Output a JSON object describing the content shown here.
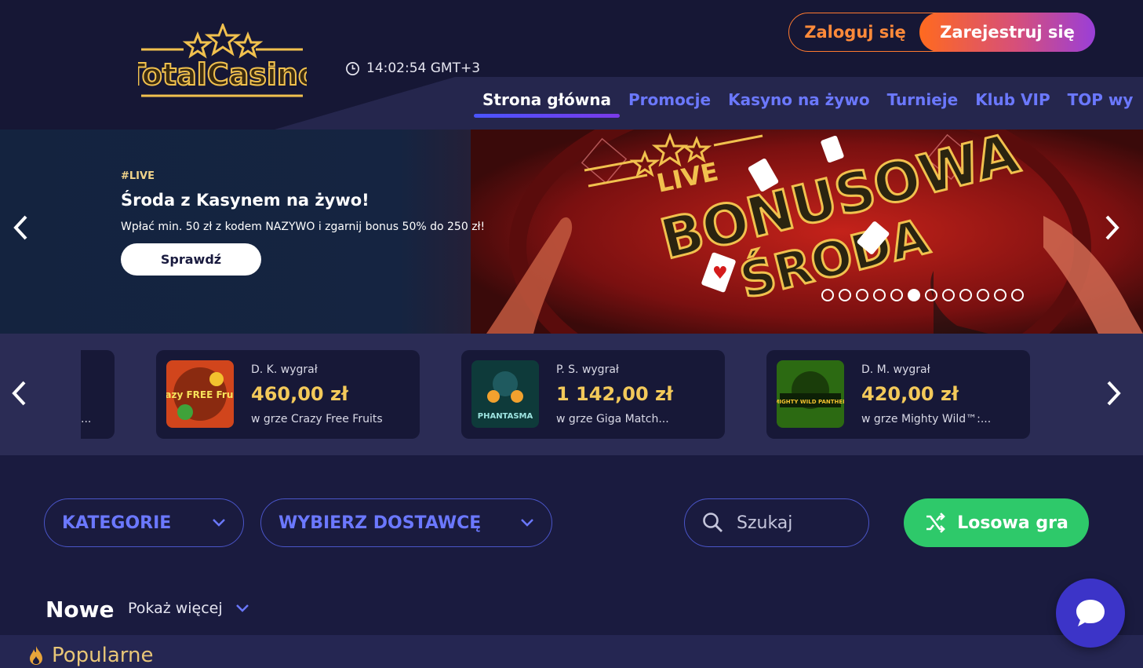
{
  "brand": {
    "logo_text": "TotalCasino"
  },
  "header": {
    "clock": "14:02:54 GMT+3",
    "login_label": "Zaloguj się",
    "register_label": "Zarejestruj się",
    "nav": [
      {
        "label": "Strona główna",
        "active": true
      },
      {
        "label": "Promocje"
      },
      {
        "label": "Kasyno na żywo"
      },
      {
        "label": "Turnieje"
      },
      {
        "label": "Klub VIP"
      },
      {
        "label": "TOP wy"
      }
    ]
  },
  "banner": {
    "tag": "#LIVE",
    "title": "Środa z Kasynem na żywo!",
    "description": "Wpłać min. 50 zł z kodem NAZYWO i zgarnij bonus 50% do 250 zł!",
    "cta": "Sprawdź",
    "art_live": "LIVE",
    "art_line1": "BONUSOWA",
    "art_line2": "ŚRODA",
    "dots_total": 12,
    "dots_active_index": 5
  },
  "winners": [
    {
      "who": "D. K. wygrał",
      "amount": "460,00 zł",
      "game": "w grze Crazy Free Fruits",
      "thumb_text": "Crazy FREE Fruits"
    },
    {
      "who": "P. S. wygrał",
      "amount": "1 142,00 zł",
      "game": "w grze Giga Match...",
      "thumb_text": "PHANTASMA"
    },
    {
      "who": "D. M. wygrał",
      "amount": "420,00 zł",
      "game": "w grze Mighty Wild™:...",
      "thumb_text": "MIGHTY WILD PANTHER"
    }
  ],
  "winners_partial_text": "...",
  "filters": {
    "categories_label": "KATEGORIE",
    "providers_label": "WYBIERZ DOSTAWCĘ",
    "search_placeholder": "Szukaj",
    "random_label": "Losowa gra"
  },
  "sections": {
    "new_title": "Nowe",
    "show_more": "Pokaż więcej",
    "popular_title": "Popularne"
  },
  "colors": {
    "accent_blue": "#6b78ff",
    "accent_orange": "#ff7a2f",
    "green": "#2ec96a",
    "gold": "#f3c95a"
  }
}
